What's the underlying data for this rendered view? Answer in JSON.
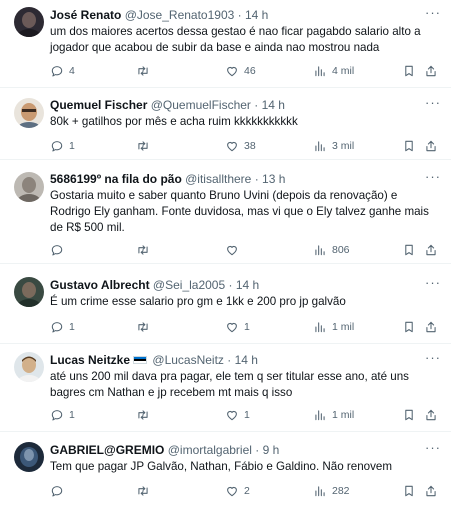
{
  "tweets": [
    {
      "name": "José Renato",
      "handle": "@Jose_Renato1903",
      "time": "14 h",
      "text": "um dos maiores acertos dessa gestao é nao ficar pagabdo salario alto a jogador que acabou de subir da base e ainda nao mostrou nada",
      "replies": "4",
      "retweets": "",
      "likes": "46",
      "views": "4 mil"
    },
    {
      "name": "Quemuel Fischer",
      "handle": "@QuemuelFischer",
      "time": "14 h",
      "text": "80k + gatilhos por mês e acha ruim kkkkkkkkkkk",
      "replies": "1",
      "retweets": "",
      "likes": "38",
      "views": "3 mil"
    },
    {
      "name": "5686199º na fila do pão",
      "handle": "@itisallthere",
      "time": "13 h",
      "text": "Gostaria muito e saber quanto Bruno Uvini (depois da renovação) e Rodrigo Ely ganham. Fonte duvidosa, mas vi que o Ely talvez ganhe mais de R$ 500 mil.",
      "replies": "",
      "retweets": "",
      "likes": "",
      "views": "806"
    },
    {
      "name": "Gustavo Albrecht",
      "handle": "@Sei_la2005",
      "time": "14 h",
      "text": "É um crime esse salario pro gm e 1kk e 200 pro jp galvão",
      "replies": "1",
      "retweets": "",
      "likes": "1",
      "views": "1 mil"
    },
    {
      "name": "Lucas Neitzke",
      "handle": "@LucasNeitz",
      "time": "14 h",
      "text": "até uns 200 mil dava pra pagar, ele tem q ser titular esse ano, até uns bagres cm Nathan  e jp recebem mt mais q isso",
      "replies": "1",
      "retweets": "",
      "likes": "1",
      "views": "1 mil"
    },
    {
      "name": "GABRIEL@GREMIO",
      "handle": "@imortalgabriel",
      "time": "9 h",
      "text": "Tem que pagar JP Galvão, Nathan, Fábio e Galdino. Não renovem",
      "replies": "",
      "retweets": "",
      "likes": "2",
      "views": "282"
    }
  ],
  "separator": "·",
  "more_glyph": "···",
  "colors": {
    "muted": "#536471",
    "text": "#0f1419",
    "divider": "#eff3f4"
  },
  "icons": [
    "reply-icon",
    "retweet-icon",
    "like-icon",
    "views-icon",
    "bookmark-icon",
    "share-icon",
    "more-icon"
  ]
}
